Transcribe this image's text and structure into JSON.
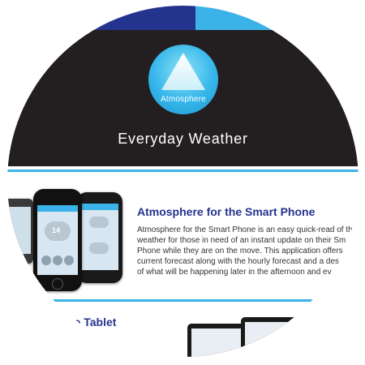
{
  "header": {
    "logo_name": "Atmosphere",
    "title": "Everyday Weather"
  },
  "section1": {
    "title": "Atmosphere for the Smart Phone",
    "body_lines": [
      "Atmosphere for the Smart Phone is an easy quick-read of th",
      "weather for those in need of an instant update on their Sm",
      "Phone while they are on the move. This application offers",
      "current forecast along with the hourly forecast and a des",
      "of what will be happening later in the afternoon and ev"
    ]
  },
  "section2": {
    "title": "he Tablet"
  },
  "phone": {
    "temperature": "14"
  },
  "colors": {
    "navy": "#24338e",
    "cyan": "#3bb3e8",
    "black": "#231f20"
  }
}
